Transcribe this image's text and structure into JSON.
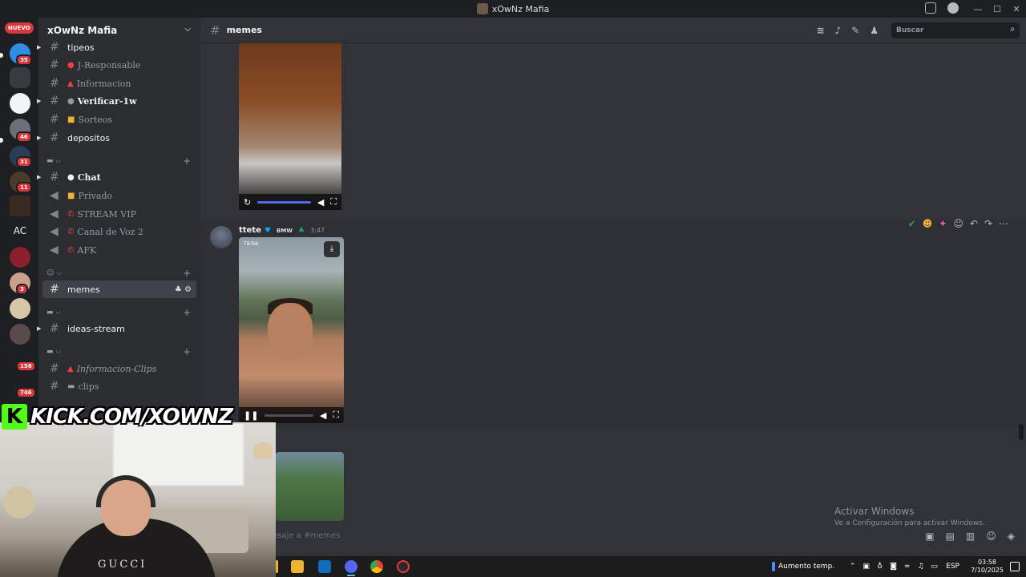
{
  "window": {
    "title": "xOwNz Mafia"
  },
  "guilds": {
    "nuevo_label": "NUEVO",
    "badges": [
      "35",
      "46",
      "31",
      "11",
      "3",
      "158",
      "746"
    ],
    "ac_label": "AC"
  },
  "server": {
    "name": "xOwNz Mafia"
  },
  "channels": [
    {
      "label": "tipeos"
    },
    {
      "label": "J-Responsable"
    },
    {
      "label": "Informacion"
    },
    {
      "label": "Verificar-1w"
    },
    {
      "label": "Sorteos"
    },
    {
      "label": "depositos"
    },
    {
      "label": "Chat"
    },
    {
      "label": "Privado"
    },
    {
      "label": "STREAM VIP"
    },
    {
      "label": "Canal de Voz 2"
    },
    {
      "label": "AFK"
    },
    {
      "label": "memes"
    },
    {
      "label": "ideas-stream"
    },
    {
      "label": "Informacion-Clips"
    },
    {
      "label": "clips"
    }
  ],
  "header": {
    "channel": "memes",
    "search_placeholder": "Buscar"
  },
  "message": {
    "username": "ttete",
    "tag": "BMW",
    "time": "3:47",
    "video_watermark": "TikTok"
  },
  "composer": {
    "placeholder": "nsaje a #memes"
  },
  "watermark": {
    "line1": "Activar Windows",
    "line2": "Ve a Configuración para activar Windows."
  },
  "overlay": {
    "kick_text": "KICK.COM/XOWNZ",
    "kick_letter": "K",
    "shirt_text": "GUCCI"
  },
  "taskbar": {
    "weather": "Aumento temp.",
    "lang": "ESP",
    "time": "03:58",
    "date": "7/10/2025"
  },
  "colors": {
    "accent": "#5865f2",
    "kick": "#53fc18",
    "badge": "#da373c"
  }
}
